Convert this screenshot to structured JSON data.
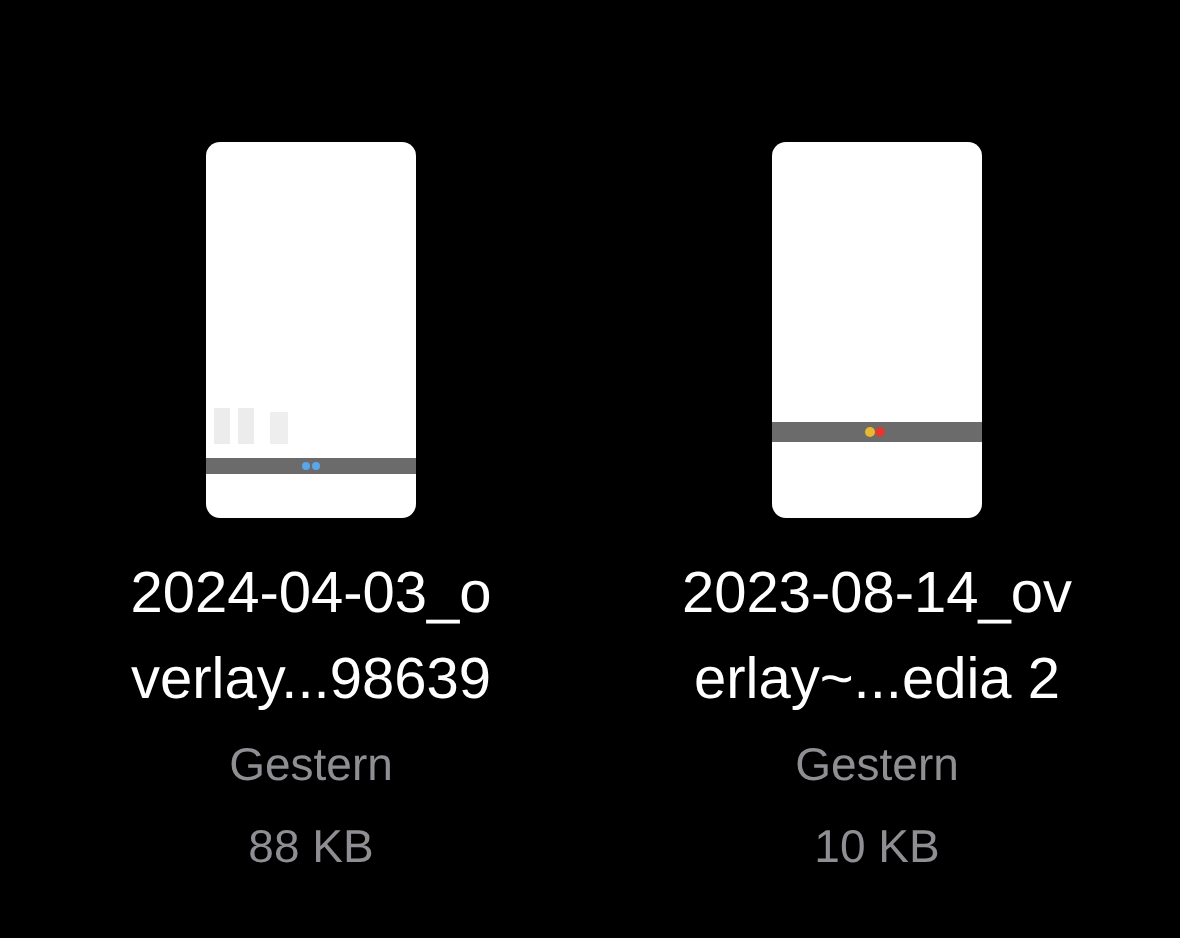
{
  "files": [
    {
      "name_lines": [
        "2024-04-03_o",
        "verlay...98639"
      ],
      "date": "Gestern",
      "size": "88 KB"
    },
    {
      "name_lines": [
        "2023-08-14_ov",
        "erlay~...edia 2"
      ],
      "date": "Gestern",
      "size": "10 KB"
    }
  ]
}
